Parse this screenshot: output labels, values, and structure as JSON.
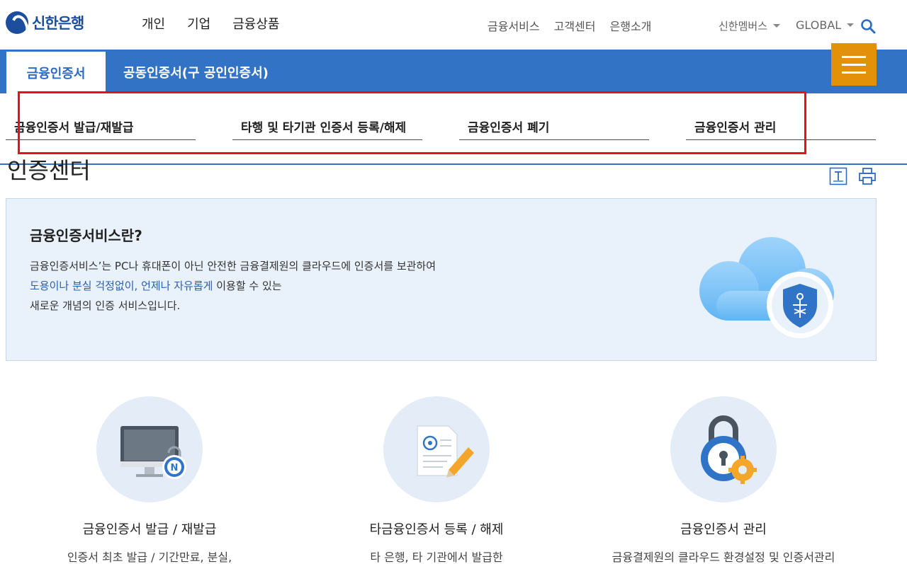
{
  "header": {
    "logo_text": "신한은행",
    "main_nav": [
      "개인",
      "기업",
      "금융상품"
    ],
    "util_nav": [
      "금융서비스",
      "고객센터",
      "은행소개"
    ],
    "member_label": "신한멤버스",
    "global_label": "GLOBAL"
  },
  "tabs": {
    "active": "금융인증서",
    "other": "공동인증서(구 공인인증서)"
  },
  "submenu": {
    "items": [
      "금융인증서 발급/재발급",
      "타행 및 타기관 인증서 등록/해제",
      "금융인증서 폐기",
      "금융인증서 관리"
    ]
  },
  "page": {
    "title": "인증센터"
  },
  "info": {
    "title": "금융인증서비스란?",
    "line1": "금융인증서비스’는 PC나 휴대폰이 아닌 안전한 금융결제원의 클라우드에 인증서를 보관하여",
    "line2_highlight": "도용이나 분실 걱정없이, 언제나 자유롭게",
    "line2_rest": " 이용할 수 있는",
    "line3": "새로운 개념의 인증 서비스입니다."
  },
  "cards": [
    {
      "title": "금융인증서 발급 / 재발급",
      "desc": "인증서 최초 발급 / 기간만료, 분실,"
    },
    {
      "title": "타금융인증서 등록 / 해제",
      "desc": "타 은행, 타 기관에서 발급한"
    },
    {
      "title": "금융인증서 관리",
      "desc": "금융결제원의 클라우드 환경설정 및 인증서관리"
    }
  ],
  "colors": {
    "brand_blue": "#3273c6",
    "menu_orange": "#e29109",
    "highlight_red": "#e8101d",
    "info_bg": "#e9f1fa"
  }
}
